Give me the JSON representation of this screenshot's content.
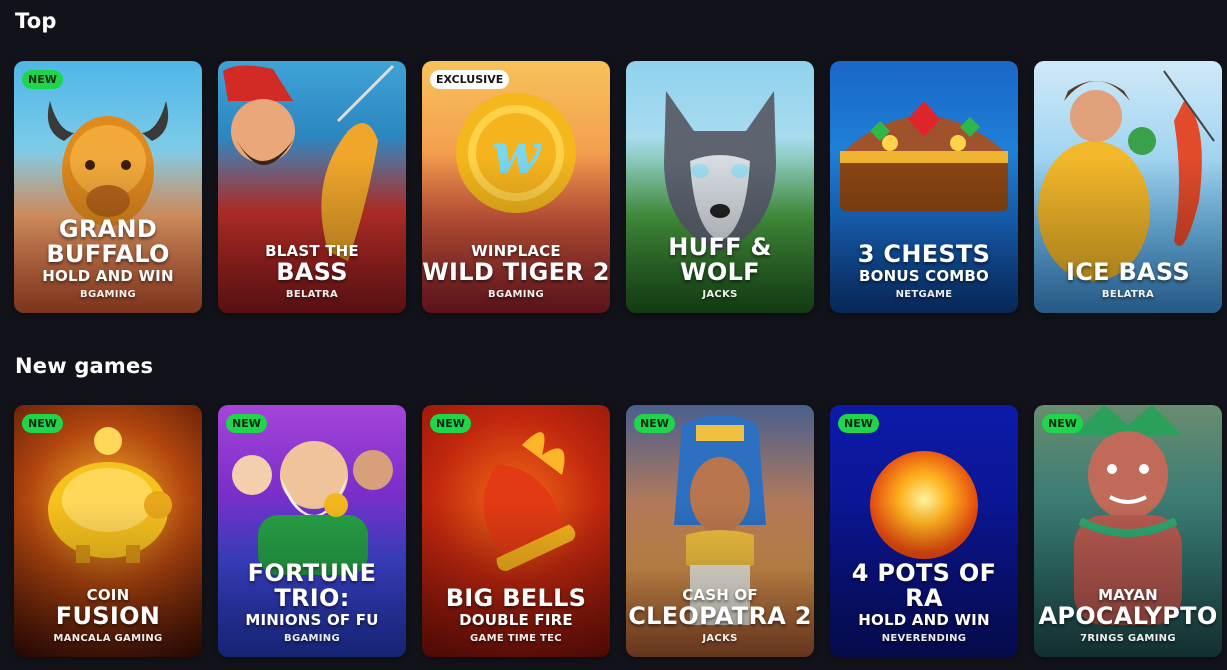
{
  "sections": {
    "top": {
      "title": "Top",
      "cards": [
        {
          "badge": "NEW",
          "line1": "GRAND",
          "line2": "BUFFALO",
          "line3": "HOLD AND WIN",
          "provider": "BGAMING"
        },
        {
          "badge": "",
          "line1": "BLAST THE",
          "line2": "BASS",
          "line3": "",
          "provider": "BELATRA"
        },
        {
          "badge": "EXCLUSIVE",
          "line1": "WINPLACE",
          "line2": "WILD TIGER 2",
          "line3": "",
          "provider": "BGAMING"
        },
        {
          "badge": "",
          "line1": "",
          "line2": "HUFF & WOLF",
          "line3": "",
          "provider": "JACKS"
        },
        {
          "badge": "",
          "line1": "",
          "line2": "3 CHESTS",
          "line3": "BONUS COMBO",
          "provider": "NETGAME"
        },
        {
          "badge": "",
          "line1": "",
          "line2": "ICE BASS",
          "line3": "",
          "provider": "BELATRA"
        }
      ]
    },
    "new_games": {
      "title": "New games",
      "cards": [
        {
          "badge": "NEW",
          "line1": "COIN",
          "line2": "FUSION",
          "line3": "",
          "provider": "MANCALA GAMING"
        },
        {
          "badge": "NEW",
          "line1": "",
          "line2": "FORTUNE TRIO:",
          "line3": "MINIONS OF FU",
          "provider": "BGAMING"
        },
        {
          "badge": "NEW",
          "line1": "",
          "line2": "BIG BELLS",
          "line3": "DOUBLE FIRE",
          "provider": "GAME TIME TEC"
        },
        {
          "badge": "NEW",
          "line1": "CASH OF",
          "line2": "CLEOPATRA 2",
          "line3": "",
          "provider": "JACKS"
        },
        {
          "badge": "NEW",
          "line1": "",
          "line2": "4 POTS OF RA",
          "line3": "HOLD AND WIN",
          "provider": "NEVERENDING"
        },
        {
          "badge": "NEW",
          "line1": "MAYAN",
          "line2": "APOCALYPTO",
          "line3": "",
          "provider": "7RINGS GAMING"
        }
      ]
    }
  },
  "icons": [
    "buffalo-art",
    "fisherman-art",
    "gold-coin-art",
    "wolf-art",
    "treasure-chest-art",
    "ice-fisherman-art",
    "piggy-bank-art",
    "wise-man-art",
    "fire-bell-art",
    "cleopatra-art",
    "sun-orb-art",
    "mayan-warrior-art"
  ]
}
